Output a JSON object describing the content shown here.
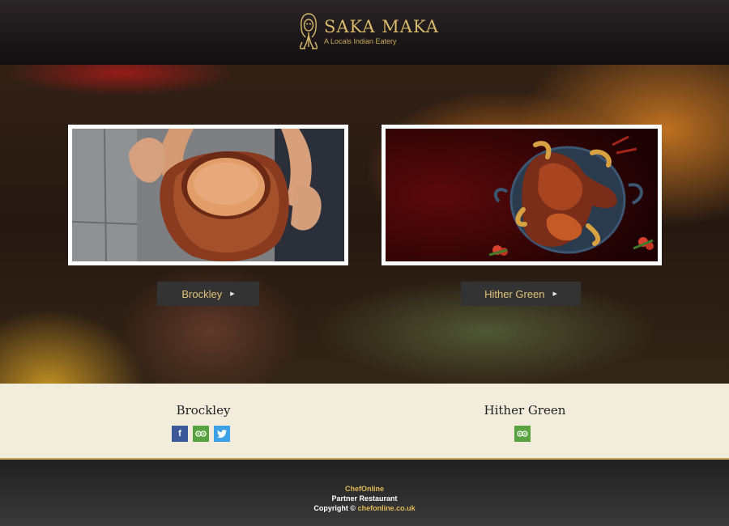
{
  "header": {
    "title": "SAKA MAKA",
    "subtitle": "A Locals Indian Eatery",
    "icon": "namaste-logo-icon"
  },
  "hero": {
    "cards": [
      {
        "image_icon": "clay-chai-cup-photo",
        "button_label": "Brockley",
        "arrow_icon": "triangle-right-icon"
      },
      {
        "image_icon": "roast-chicken-photo",
        "button_label": "Hither Green",
        "arrow_icon": "triangle-right-icon"
      }
    ]
  },
  "locations": [
    {
      "name": "Brockley",
      "socials": [
        "facebook-icon",
        "tripadvisor-icon",
        "twitter-icon"
      ]
    },
    {
      "name": "Hither Green",
      "socials": [
        "tripadvisor-icon"
      ]
    }
  ],
  "footer": {
    "brand": "ChefOnline",
    "tagline": "Partner Restaurant",
    "copyright_prefix": "Copyright ©",
    "link": "chefonline.co.uk"
  },
  "colors": {
    "accent_gold": "#e1b857",
    "cta_bg": "#333333",
    "cream": "#f1ecdc",
    "facebook": "#3b5998",
    "tripadvisor": "#58a33f",
    "twitter": "#3ea1e5"
  }
}
